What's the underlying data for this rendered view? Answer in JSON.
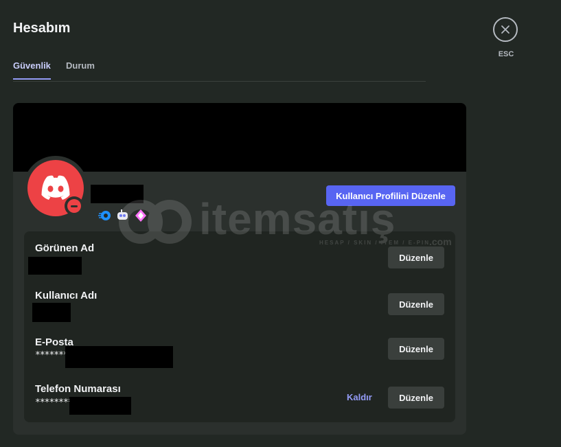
{
  "header": {
    "title": "Hesabım"
  },
  "tabs": [
    {
      "label": "Güvenlik",
      "active": true
    },
    {
      "label": "Durum",
      "active": false
    }
  ],
  "close": {
    "label": "ESC",
    "icon": "close-icon"
  },
  "profile": {
    "edit_profile_label": "Kullanıcı Profilini Düzenle",
    "avatar_color": "#ed4245",
    "status": "do-not-disturb",
    "badges": [
      "nitro-badge",
      "quest-badge",
      "boost-badge"
    ]
  },
  "fields": [
    {
      "label": "Görünen Ad",
      "value": "",
      "edit_label": "Düzenle"
    },
    {
      "label": "Kullanıcı Adı",
      "value": "",
      "edit_label": "Düzenle"
    },
    {
      "label": "E-Posta",
      "value": "*******",
      "edit_label": "Düzenle"
    },
    {
      "label": "Telefon Numarası",
      "value": "********",
      "edit_label": "Düzenle",
      "remove_label": "Kaldır"
    }
  ],
  "watermark": {
    "text": "itemsatış",
    "sub": "HESAP / SKIN / ITEM / E-PIN",
    "suffix": ".com"
  },
  "colors": {
    "accent": "#5865f2",
    "link": "#949cf7",
    "background": "#222824",
    "card": "#2b302d",
    "danger": "#ed4245"
  }
}
